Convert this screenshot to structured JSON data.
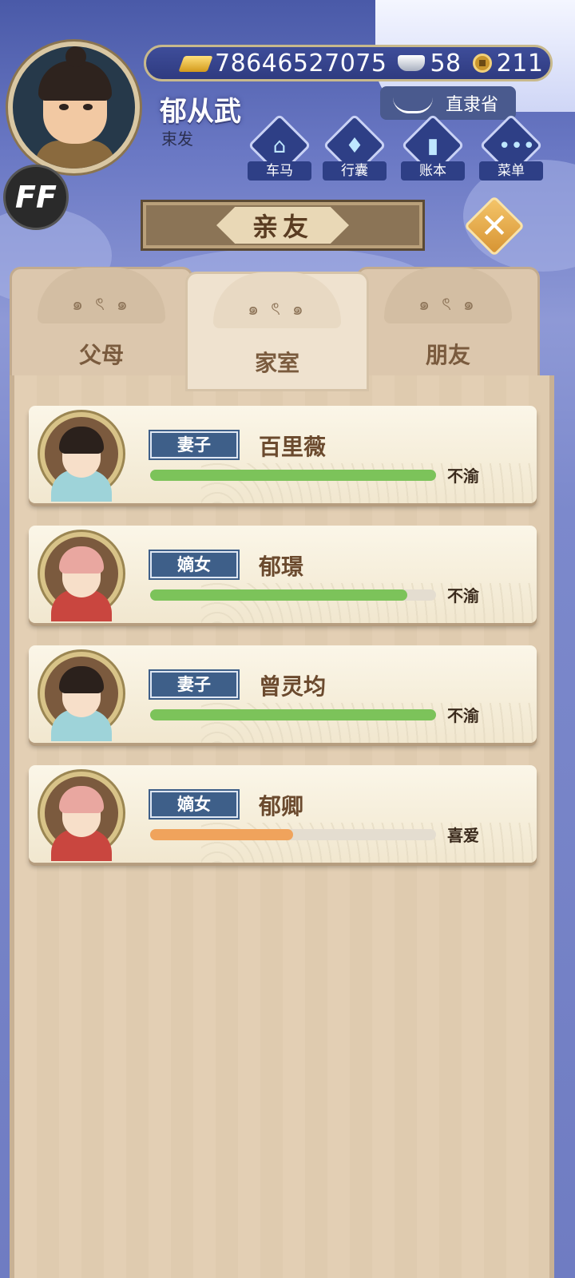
{
  "player": {
    "name": "郁从武",
    "title": "束发",
    "badge": "FF"
  },
  "resources": {
    "gold": "78646527075",
    "silver": "58",
    "coins": "211"
  },
  "location": "直隶省",
  "nav": [
    {
      "label": "车马",
      "icon": "carriage-icon"
    },
    {
      "label": "行囊",
      "icon": "bag-icon"
    },
    {
      "label": "账本",
      "icon": "ledger-icon"
    },
    {
      "label": "菜单",
      "icon": "menu-dots-icon"
    }
  ],
  "page_title": "亲友",
  "tabs": [
    {
      "label": "父母",
      "active": false
    },
    {
      "label": "家室",
      "active": true
    },
    {
      "label": "朋友",
      "active": false
    }
  ],
  "relatives": [
    {
      "relation": "妻子",
      "name": "百里薇",
      "mood": "不渝",
      "affection": 1.0,
      "bar_color": "#7cc35a"
    },
    {
      "relation": "嫡女",
      "name": "郁璟",
      "mood": "不渝",
      "affection": 0.9,
      "bar_color": "#7cc35a"
    },
    {
      "relation": "妻子",
      "name": "曾灵均",
      "mood": "不渝",
      "affection": 1.0,
      "bar_color": "#7cc35a"
    },
    {
      "relation": "嫡女",
      "name": "郁卿",
      "mood": "喜爱",
      "affection": 0.5,
      "bar_color": "#f0a35c"
    }
  ]
}
